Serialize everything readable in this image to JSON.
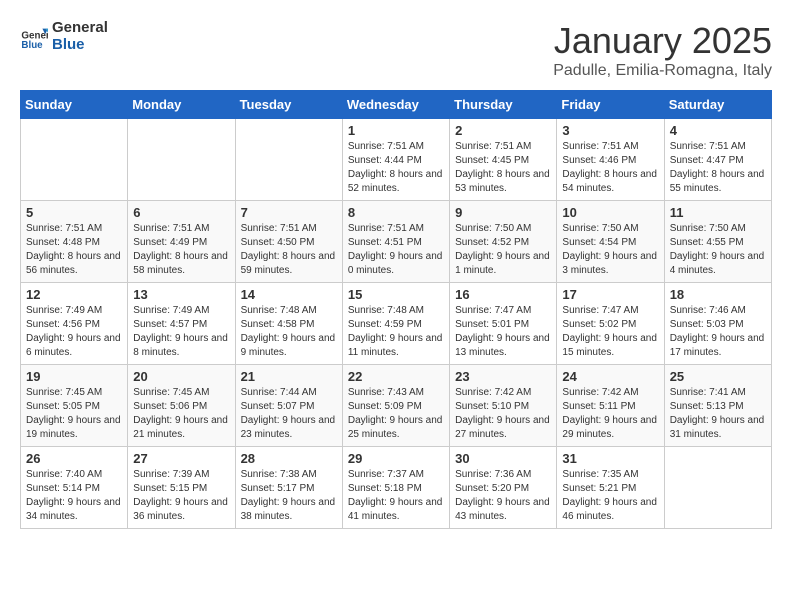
{
  "logo": {
    "text_general": "General",
    "text_blue": "Blue"
  },
  "header": {
    "title": "January 2025",
    "subtitle": "Padulle, Emilia-Romagna, Italy"
  },
  "days_of_week": [
    "Sunday",
    "Monday",
    "Tuesday",
    "Wednesday",
    "Thursday",
    "Friday",
    "Saturday"
  ],
  "weeks": [
    [
      {
        "day": "",
        "info": ""
      },
      {
        "day": "",
        "info": ""
      },
      {
        "day": "",
        "info": ""
      },
      {
        "day": "1",
        "info": "Sunrise: 7:51 AM\nSunset: 4:44 PM\nDaylight: 8 hours and 52 minutes."
      },
      {
        "day": "2",
        "info": "Sunrise: 7:51 AM\nSunset: 4:45 PM\nDaylight: 8 hours and 53 minutes."
      },
      {
        "day": "3",
        "info": "Sunrise: 7:51 AM\nSunset: 4:46 PM\nDaylight: 8 hours and 54 minutes."
      },
      {
        "day": "4",
        "info": "Sunrise: 7:51 AM\nSunset: 4:47 PM\nDaylight: 8 hours and 55 minutes."
      }
    ],
    [
      {
        "day": "5",
        "info": "Sunrise: 7:51 AM\nSunset: 4:48 PM\nDaylight: 8 hours and 56 minutes."
      },
      {
        "day": "6",
        "info": "Sunrise: 7:51 AM\nSunset: 4:49 PM\nDaylight: 8 hours and 58 minutes."
      },
      {
        "day": "7",
        "info": "Sunrise: 7:51 AM\nSunset: 4:50 PM\nDaylight: 8 hours and 59 minutes."
      },
      {
        "day": "8",
        "info": "Sunrise: 7:51 AM\nSunset: 4:51 PM\nDaylight: 9 hours and 0 minutes."
      },
      {
        "day": "9",
        "info": "Sunrise: 7:50 AM\nSunset: 4:52 PM\nDaylight: 9 hours and 1 minute."
      },
      {
        "day": "10",
        "info": "Sunrise: 7:50 AM\nSunset: 4:54 PM\nDaylight: 9 hours and 3 minutes."
      },
      {
        "day": "11",
        "info": "Sunrise: 7:50 AM\nSunset: 4:55 PM\nDaylight: 9 hours and 4 minutes."
      }
    ],
    [
      {
        "day": "12",
        "info": "Sunrise: 7:49 AM\nSunset: 4:56 PM\nDaylight: 9 hours and 6 minutes."
      },
      {
        "day": "13",
        "info": "Sunrise: 7:49 AM\nSunset: 4:57 PM\nDaylight: 9 hours and 8 minutes."
      },
      {
        "day": "14",
        "info": "Sunrise: 7:48 AM\nSunset: 4:58 PM\nDaylight: 9 hours and 9 minutes."
      },
      {
        "day": "15",
        "info": "Sunrise: 7:48 AM\nSunset: 4:59 PM\nDaylight: 9 hours and 11 minutes."
      },
      {
        "day": "16",
        "info": "Sunrise: 7:47 AM\nSunset: 5:01 PM\nDaylight: 9 hours and 13 minutes."
      },
      {
        "day": "17",
        "info": "Sunrise: 7:47 AM\nSunset: 5:02 PM\nDaylight: 9 hours and 15 minutes."
      },
      {
        "day": "18",
        "info": "Sunrise: 7:46 AM\nSunset: 5:03 PM\nDaylight: 9 hours and 17 minutes."
      }
    ],
    [
      {
        "day": "19",
        "info": "Sunrise: 7:45 AM\nSunset: 5:05 PM\nDaylight: 9 hours and 19 minutes."
      },
      {
        "day": "20",
        "info": "Sunrise: 7:45 AM\nSunset: 5:06 PM\nDaylight: 9 hours and 21 minutes."
      },
      {
        "day": "21",
        "info": "Sunrise: 7:44 AM\nSunset: 5:07 PM\nDaylight: 9 hours and 23 minutes."
      },
      {
        "day": "22",
        "info": "Sunrise: 7:43 AM\nSunset: 5:09 PM\nDaylight: 9 hours and 25 minutes."
      },
      {
        "day": "23",
        "info": "Sunrise: 7:42 AM\nSunset: 5:10 PM\nDaylight: 9 hours and 27 minutes."
      },
      {
        "day": "24",
        "info": "Sunrise: 7:42 AM\nSunset: 5:11 PM\nDaylight: 9 hours and 29 minutes."
      },
      {
        "day": "25",
        "info": "Sunrise: 7:41 AM\nSunset: 5:13 PM\nDaylight: 9 hours and 31 minutes."
      }
    ],
    [
      {
        "day": "26",
        "info": "Sunrise: 7:40 AM\nSunset: 5:14 PM\nDaylight: 9 hours and 34 minutes."
      },
      {
        "day": "27",
        "info": "Sunrise: 7:39 AM\nSunset: 5:15 PM\nDaylight: 9 hours and 36 minutes."
      },
      {
        "day": "28",
        "info": "Sunrise: 7:38 AM\nSunset: 5:17 PM\nDaylight: 9 hours and 38 minutes."
      },
      {
        "day": "29",
        "info": "Sunrise: 7:37 AM\nSunset: 5:18 PM\nDaylight: 9 hours and 41 minutes."
      },
      {
        "day": "30",
        "info": "Sunrise: 7:36 AM\nSunset: 5:20 PM\nDaylight: 9 hours and 43 minutes."
      },
      {
        "day": "31",
        "info": "Sunrise: 7:35 AM\nSunset: 5:21 PM\nDaylight: 9 hours and 46 minutes."
      },
      {
        "day": "",
        "info": ""
      }
    ]
  ]
}
